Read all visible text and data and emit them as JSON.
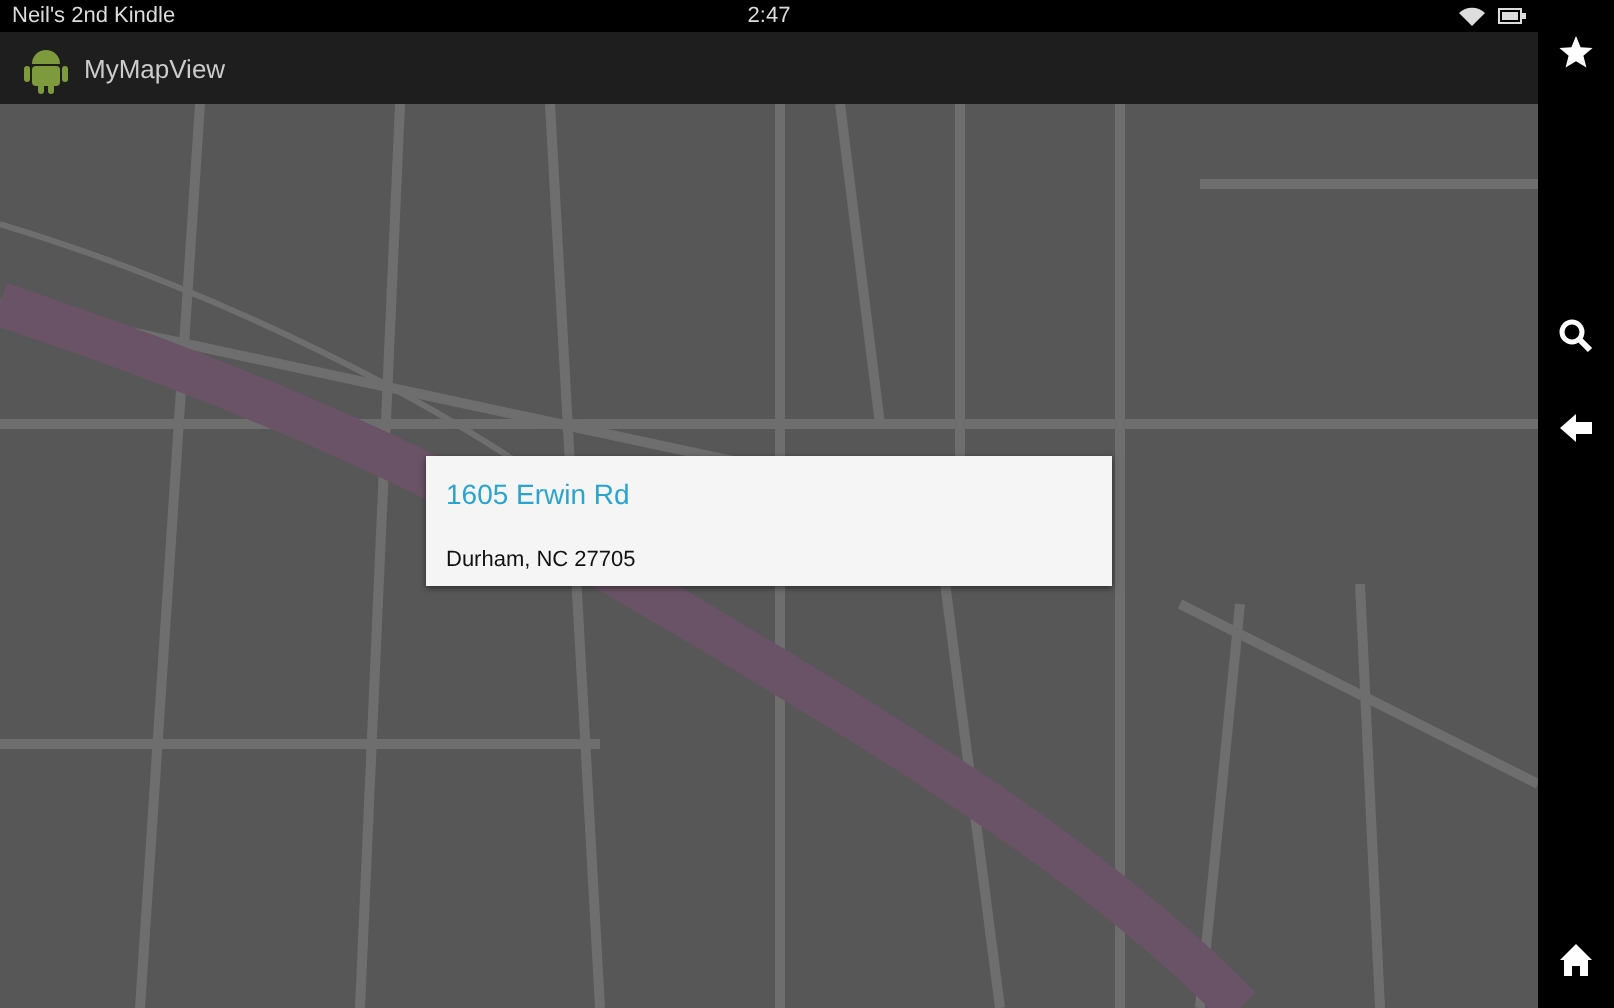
{
  "status_bar": {
    "device_name": "Neil's 2nd Kindle",
    "time": "2:47"
  },
  "app_bar": {
    "title": "MyMapView"
  },
  "map": {
    "popup": {
      "title": "1605 Erwin Rd",
      "address": "Durham, NC 27705"
    }
  },
  "side_bar": {
    "buttons": [
      {
        "kind": "star"
      },
      {
        "kind": "search"
      },
      {
        "kind": "back"
      },
      {
        "kind": "home"
      }
    ]
  }
}
